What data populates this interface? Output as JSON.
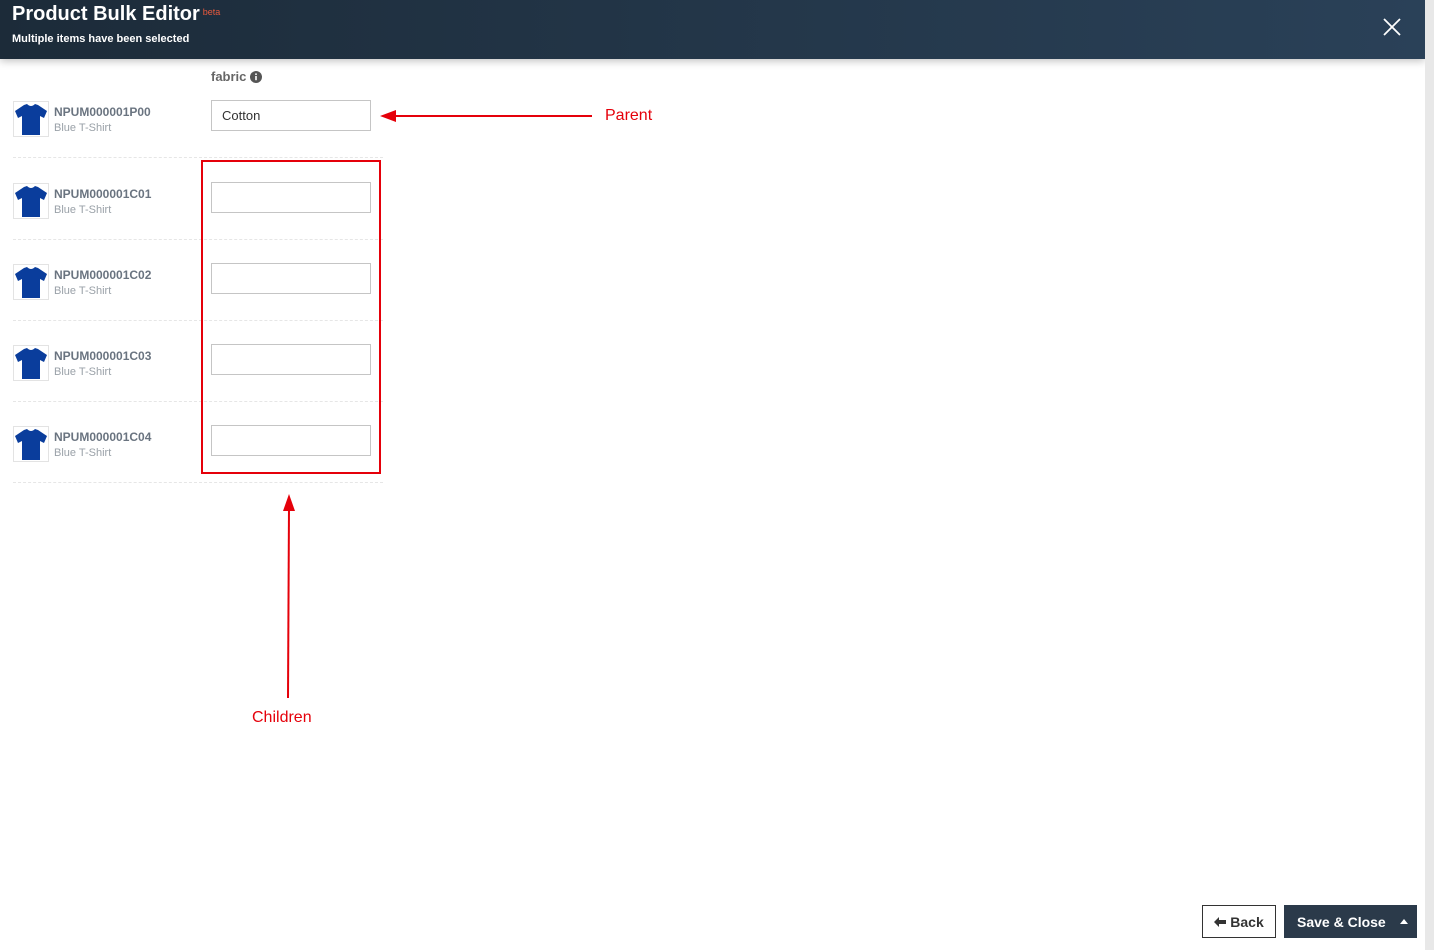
{
  "header": {
    "title": "Product Bulk Editor",
    "badge": "beta",
    "subtitle": "Multiple items have been selected"
  },
  "column": {
    "label": "fabric"
  },
  "rows": [
    {
      "sku": "NPUM000001P00",
      "name": "Blue T-Shirt",
      "value": "Cotton"
    },
    {
      "sku": "NPUM000001C01",
      "name": "Blue T-Shirt",
      "value": ""
    },
    {
      "sku": "NPUM000001C02",
      "name": "Blue T-Shirt",
      "value": ""
    },
    {
      "sku": "NPUM000001C03",
      "name": "Blue T-Shirt",
      "value": ""
    },
    {
      "sku": "NPUM000001C04",
      "name": "Blue T-Shirt",
      "value": ""
    }
  ],
  "annotations": {
    "parent_label": "Parent",
    "children_label": "Children"
  },
  "footer": {
    "back_label": "Back",
    "save_label": "Save & Close"
  },
  "colors": {
    "header_bg": "#1c2b39",
    "annotation": "#e5000a",
    "shirt": "#0a3d9c",
    "save_bg": "#2b3a4a"
  },
  "icons": {
    "close": "close-icon",
    "info": "info-icon",
    "back": "arrow-left-icon",
    "caret": "caret-up-icon",
    "thumb": "tshirt-icon"
  }
}
